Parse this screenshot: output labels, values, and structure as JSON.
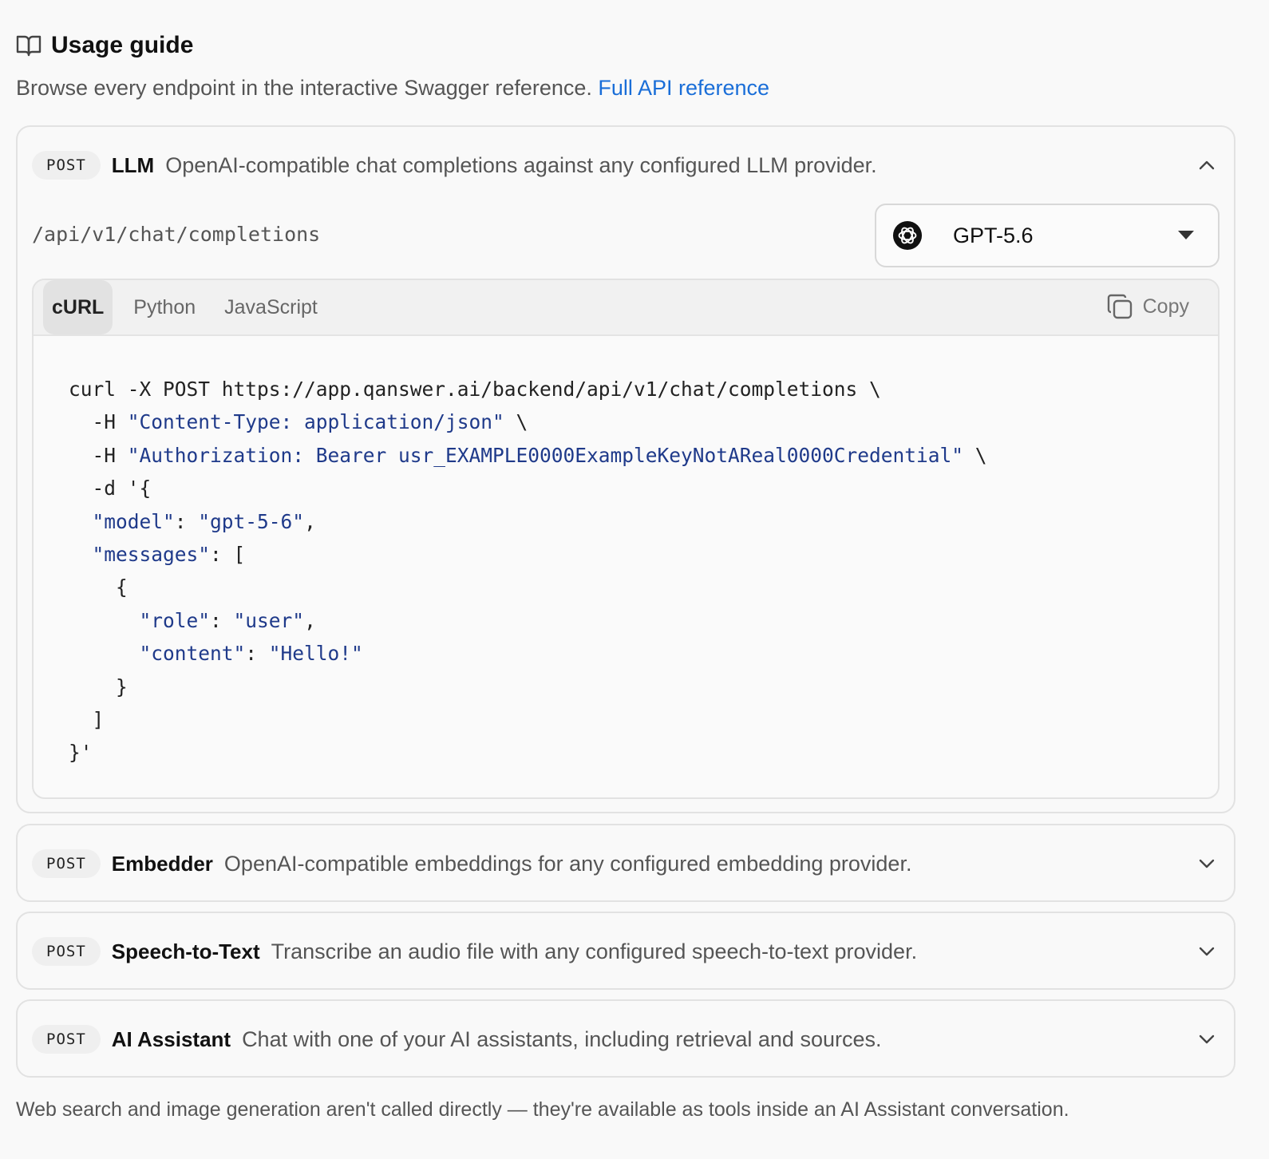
{
  "header": {
    "title": "Usage guide",
    "subtitle": "Browse every endpoint in the interactive Swagger reference.",
    "link_label": "Full API reference"
  },
  "endpoints": [
    {
      "method": "POST",
      "name": "LLM",
      "description": "OpenAI-compatible chat completions against any configured LLM provider.",
      "expanded": true,
      "path": "/api/v1/chat/completions",
      "model": "GPT-5.6",
      "tabs": [
        "cURL",
        "Python",
        "JavaScript"
      ],
      "active_tab": "cURL",
      "copy_label": "Copy",
      "code_lines": [
        "curl -X POST https://app.qanswer.ai/backend/api/v1/chat/completions \\",
        "  -H \"Content-Type: application/json\" \\",
        "  -H \"Authorization: Bearer usr_EXAMPLE0000ExampleKeyNotAReal0000Credential\" \\",
        "  -d '{",
        "  \"model\": \"gpt-5-6\",",
        "  \"messages\": [",
        "    {",
        "      \"role\": \"user\",",
        "      \"content\": \"Hello!\"",
        "    }",
        "  ]",
        "}'"
      ]
    },
    {
      "method": "POST",
      "name": "Embedder",
      "description": "OpenAI-compatible embeddings for any configured embedding provider.",
      "expanded": false
    },
    {
      "method": "POST",
      "name": "Speech-to-Text",
      "description": "Transcribe an audio file with any configured speech-to-text provider.",
      "expanded": false
    },
    {
      "method": "POST",
      "name": "AI Assistant",
      "description": "Chat with one of your AI assistants, including retrieval and sources.",
      "expanded": false
    }
  ],
  "footer_note": "Web search and image generation aren't called directly — they're available as tools inside an AI Assistant conversation.",
  "colors": {
    "link": "#1a6ed8",
    "code_string": "#1f3a8a"
  },
  "icons": {
    "header": "book-open-icon",
    "collapse": "chevron-up-icon",
    "expand": "chevron-down-icon",
    "model": "openai-logo-icon",
    "copy": "copy-icon"
  }
}
